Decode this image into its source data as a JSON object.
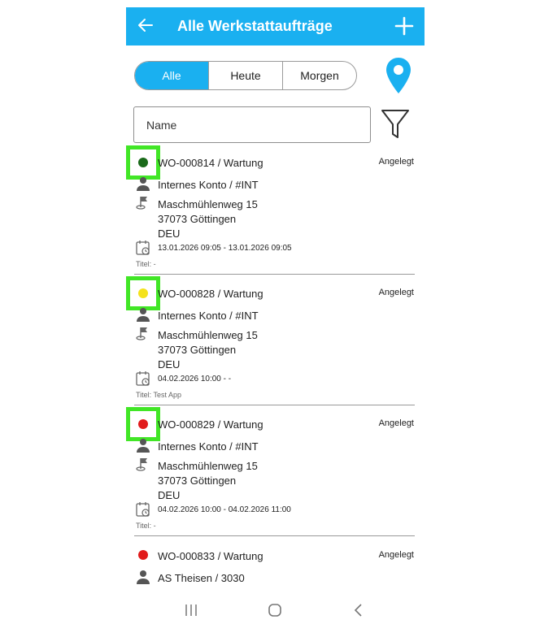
{
  "header": {
    "title": "Alle Werkstattaufträge"
  },
  "tabs": [
    {
      "label": "Alle",
      "selected": true
    },
    {
      "label": "Heute",
      "selected": false
    },
    {
      "label": "Morgen",
      "selected": false
    }
  ],
  "search": {
    "placeholder": "Name"
  },
  "icons": {
    "back": "arrow-left-icon",
    "add": "plus-icon",
    "location": "map-pin-icon",
    "filter": "filter-icon"
  },
  "colors": {
    "accent": "#1ab0f0",
    "highlight": "#41e626"
  },
  "orders": [
    {
      "id": "WO-000814 / Wartung",
      "status": "Angelegt",
      "status_color": "#1a6a1a",
      "account": "Internes Konto / #INT",
      "addr1": "Maschmühlenweg 15",
      "addr2": "37073 Göttingen",
      "addr3": "DEU",
      "date": "13.01.2026 09:05 - 13.01.2026 09:05",
      "titel": "Titel: -",
      "highlighted": true
    },
    {
      "id": "WO-000828 / Wartung",
      "status": "Angelegt",
      "status_color": "#f4e21b",
      "account": "Internes Konto / #INT",
      "addr1": "Maschmühlenweg 15",
      "addr2": "37073 Göttingen",
      "addr3": "DEU",
      "date": "04.02.2026 10:00 - -",
      "titel": "Titel: Test App",
      "highlighted": true
    },
    {
      "id": "WO-000829 / Wartung",
      "status": "Angelegt",
      "status_color": "#e11b1b",
      "account": "Internes Konto / #INT",
      "addr1": "Maschmühlenweg 15",
      "addr2": "37073 Göttingen",
      "addr3": "DEU",
      "date": "04.02.2026 10:00 - 04.02.2026 11:00",
      "titel": "Titel: -",
      "highlighted": true
    },
    {
      "id": "WO-000833 / Wartung",
      "status": "Angelegt",
      "status_color": "#e11b1b",
      "account": "AS Theisen / 3030",
      "addr1": "",
      "addr2": "",
      "addr3": "",
      "date": "",
      "titel": "",
      "highlighted": false
    }
  ],
  "navbar": {
    "recent": "recent-apps-icon",
    "home": "home-icon",
    "back": "back-icon"
  }
}
